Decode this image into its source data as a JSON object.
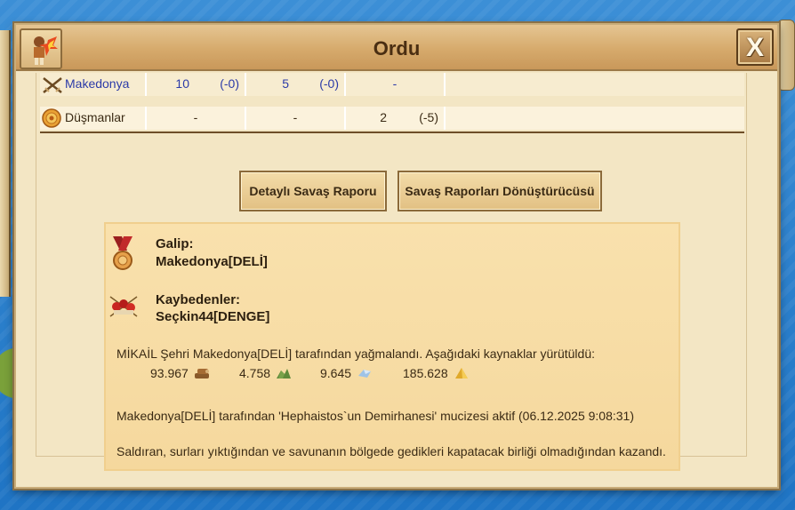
{
  "window": {
    "title": "Ordu",
    "close_label": "X"
  },
  "table": {
    "rows": [
      {
        "name": "Makedonya",
        "icon": "crossed-swords-icon",
        "c1": "10",
        "c2": "(-0)",
        "c3": "5",
        "c4": "(-0)",
        "c5": "-",
        "c6": ""
      },
      {
        "name": "Düşmanlar",
        "icon": "enemy-shield-icon",
        "c1": "-",
        "c2": "",
        "c3": "-",
        "c4": "",
        "c5": "2",
        "c6": "(-5)"
      }
    ]
  },
  "buttons": {
    "detailed_report": "Detaylı Savaş Raporu",
    "converter": "Savaş Raporları Dönüştürücüsü"
  },
  "result": {
    "winner_label": "Galip:",
    "winner_name": "Makedonya[DELİ]",
    "losers_label": "Kaybedenler:",
    "loser_name": "Seçkin44[DENGE]",
    "plunder_text": "MİKAİL Şehri Makedonya[DELİ] tarafından yağmalandı. Aşağıdaki kaynaklar yürütüldü:",
    "resources": [
      {
        "value": "93.967",
        "icon": "wood-icon"
      },
      {
        "value": "4.758",
        "icon": "stone-icon"
      },
      {
        "value": "9.645",
        "icon": "silver-icon"
      },
      {
        "value": "185.628",
        "icon": "favor-icon"
      }
    ],
    "wonder_text": "Makedonya[DELİ] tarafından 'Hephaistos`un Demirhanesi' mucizesi aktif (06.12.2025 9:08:31)",
    "outcome_text": "Saldıran, surları yıktığından ve savunanın bölgede gedikleri kapatacak birliği olmadığından kazandı."
  },
  "colors": {
    "titlebar": "#d6aa6c",
    "panel": "#f3e6c4",
    "result_bg": "#f7dca3",
    "link_blue": "#2b3aa8"
  }
}
